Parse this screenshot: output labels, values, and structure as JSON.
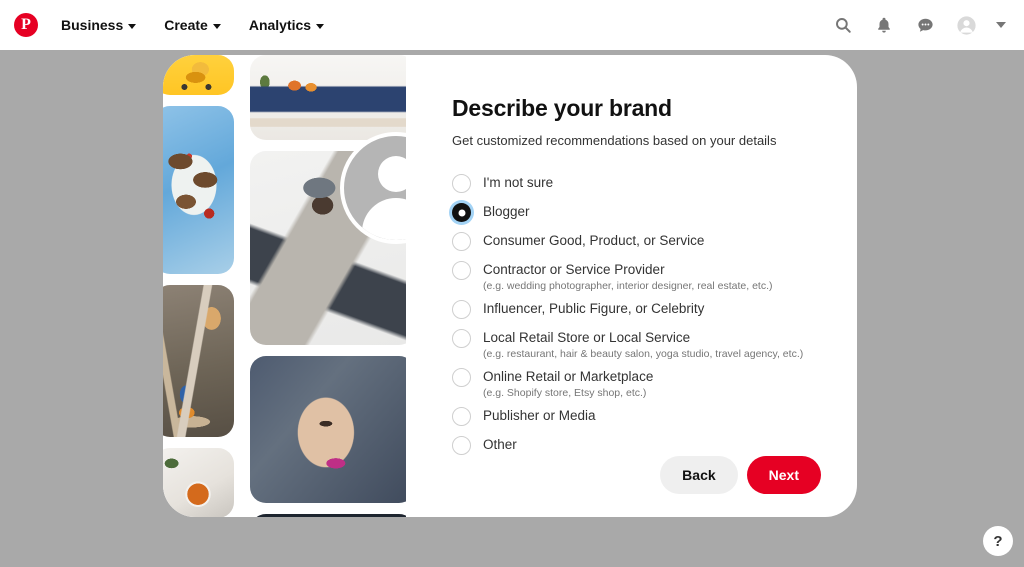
{
  "nav": {
    "logo": "pinterest-logo",
    "items": [
      {
        "label": "Business",
        "icon": "chevron-down-icon"
      },
      {
        "label": "Create",
        "icon": "chevron-down-icon"
      },
      {
        "label": "Analytics",
        "icon": "chevron-down-icon"
      }
    ],
    "right_icons": [
      {
        "name": "search-icon",
        "glyph": "search"
      },
      {
        "name": "notifications-bell-icon",
        "glyph": "bell"
      },
      {
        "name": "messages-icon",
        "glyph": "chat"
      },
      {
        "name": "account-avatar-icon",
        "glyph": "person"
      },
      {
        "name": "chevron-down-icon",
        "glyph": "chevron"
      }
    ]
  },
  "card": {
    "title": "Describe your brand",
    "subtitle": "Get customized recommendations based on your details",
    "options": [
      {
        "label": "I'm not sure",
        "sub": "",
        "selected": false
      },
      {
        "label": "Blogger",
        "sub": "",
        "selected": true
      },
      {
        "label": "Consumer Good, Product, or Service",
        "sub": "",
        "selected": false
      },
      {
        "label": "Contractor or Service Provider",
        "sub": "(e.g. wedding photographer, interior designer, real estate, etc.)",
        "selected": false
      },
      {
        "label": "Influencer, Public Figure, or Celebrity",
        "sub": "",
        "selected": false
      },
      {
        "label": "Local Retail Store or Local Service",
        "sub": "(e.g. restaurant, hair & beauty salon, yoga studio, travel agency, etc.)",
        "selected": false
      },
      {
        "label": "Online Retail or Marketplace",
        "sub": "(e.g. Shopify store, Etsy shop, etc.)",
        "selected": false
      },
      {
        "label": "Publisher or Media",
        "sub": "",
        "selected": false
      },
      {
        "label": "Other",
        "sub": "",
        "selected": false
      }
    ],
    "back_label": "Back",
    "next_label": "Next"
  },
  "avatar": {
    "name": "profile-avatar-placeholder",
    "edit_icon": "pencil-edit-icon"
  },
  "collage": {
    "tiles": [
      {
        "name": "collage-tile-yellow-toy-car",
        "class": "t-yellow"
      },
      {
        "name": "collage-tile-food-platter",
        "class": "t-food-blue"
      },
      {
        "name": "collage-tile-wooden-playset",
        "class": "t-playset"
      },
      {
        "name": "collage-tile-food-bowl",
        "class": "t-bowl"
      },
      {
        "name": "collage-tile-blue-sofa-livingroom",
        "class": "t-sofa"
      },
      {
        "name": "collage-tile-person-grey-jacket",
        "class": "t-person"
      },
      {
        "name": "collage-tile-woman-portrait",
        "class": "t-portrait"
      },
      {
        "name": "collage-tile-string-lights",
        "class": "t-lights"
      }
    ]
  },
  "help": {
    "label": "?"
  },
  "colors": {
    "pinterest_red": "#e60023",
    "page_background": "#a9a9a9",
    "card_background": "#ffffff",
    "focus_ring": "#a3d3f5",
    "muted_text": "#767676"
  }
}
